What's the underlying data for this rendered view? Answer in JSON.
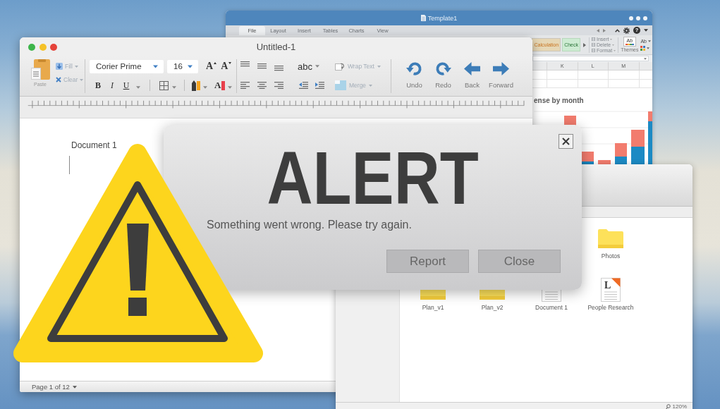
{
  "spreadsheet_window": {
    "title": "Template1",
    "tabs": [
      {
        "label": "File",
        "selected": true
      },
      {
        "label": "Layout",
        "selected": false
      },
      {
        "label": "Insert",
        "selected": false
      },
      {
        "label": "Tables",
        "selected": false
      },
      {
        "label": "Charts",
        "selected": false
      },
      {
        "label": "View",
        "selected": false
      }
    ],
    "help_button": "?",
    "cell_styles": [
      {
        "label": "Calculation",
        "kind": "calculation"
      },
      {
        "label": "Check",
        "kind": "check"
      }
    ],
    "cells_buttons": [
      "Insert",
      "Delete",
      "Format"
    ],
    "themes": {
      "theme_button": "Ab",
      "label": "Themes",
      "fonts_button": "Ab"
    },
    "column_headers": [
      "K",
      "L",
      "M"
    ],
    "chart_title": "ense by month"
  },
  "word_window": {
    "title": "Untitled-1",
    "window_buttons": [
      {
        "color": "#3db54a"
      },
      {
        "color": "#f5c228"
      },
      {
        "color": "#e5433a"
      }
    ],
    "toolbar": {
      "paste_label": "Paste",
      "edit_buttons": [
        {
          "label": "Fill",
          "kind": "fill",
          "disabled": true
        },
        {
          "label": "Clear",
          "kind": "clear",
          "disabled": true
        }
      ],
      "font": "Corier Prime",
      "font_size": "16",
      "size_buttons": [
        {
          "glyph": "A",
          "kind": "grow"
        },
        {
          "glyph": "A",
          "kind": "shrink"
        }
      ],
      "format_buttons": [
        {
          "glyph": "B",
          "kind": "bold"
        },
        {
          "glyph": "I",
          "kind": "italic"
        },
        {
          "glyph": "U",
          "kind": "underline"
        }
      ],
      "color_tools": [
        {
          "kind": "highlight",
          "color": "#f5a31f"
        },
        {
          "kind": "font",
          "glyph": "A",
          "color": "#e8404c"
        }
      ],
      "spell_button": "abc",
      "layout_buttons": [
        {
          "label": "Wrap Text",
          "kind": "wrap",
          "disabled": true
        },
        {
          "label": "Merge",
          "kind": "merge",
          "disabled": true
        }
      ],
      "nav_buttons": [
        {
          "label": "Undo",
          "kind": "undo"
        },
        {
          "label": "Redo",
          "kind": "redo"
        },
        {
          "label": "Back",
          "kind": "back"
        },
        {
          "label": "Forward",
          "kind": "forward"
        }
      ]
    },
    "document_text": "Document 1",
    "status": "Page 1 of 12"
  },
  "file_browser": {
    "rows": [
      [
        "",
        "",
        "",
        {
          "label": "Photos",
          "kind": "folder"
        }
      ],
      [
        {
          "label": "Plan_v1",
          "kind": "folder"
        },
        {
          "label": "Plan_v2",
          "kind": "folder"
        },
        {
          "label": "Document 1",
          "kind": "document"
        },
        {
          "label": "People Research",
          "kind": "report",
          "glyph": "L"
        }
      ]
    ],
    "zoom": "120%"
  },
  "alert": {
    "title": "ALERT",
    "message": "Something went wrong. Please try again.",
    "buttons": [
      "Report",
      "Close"
    ]
  }
}
